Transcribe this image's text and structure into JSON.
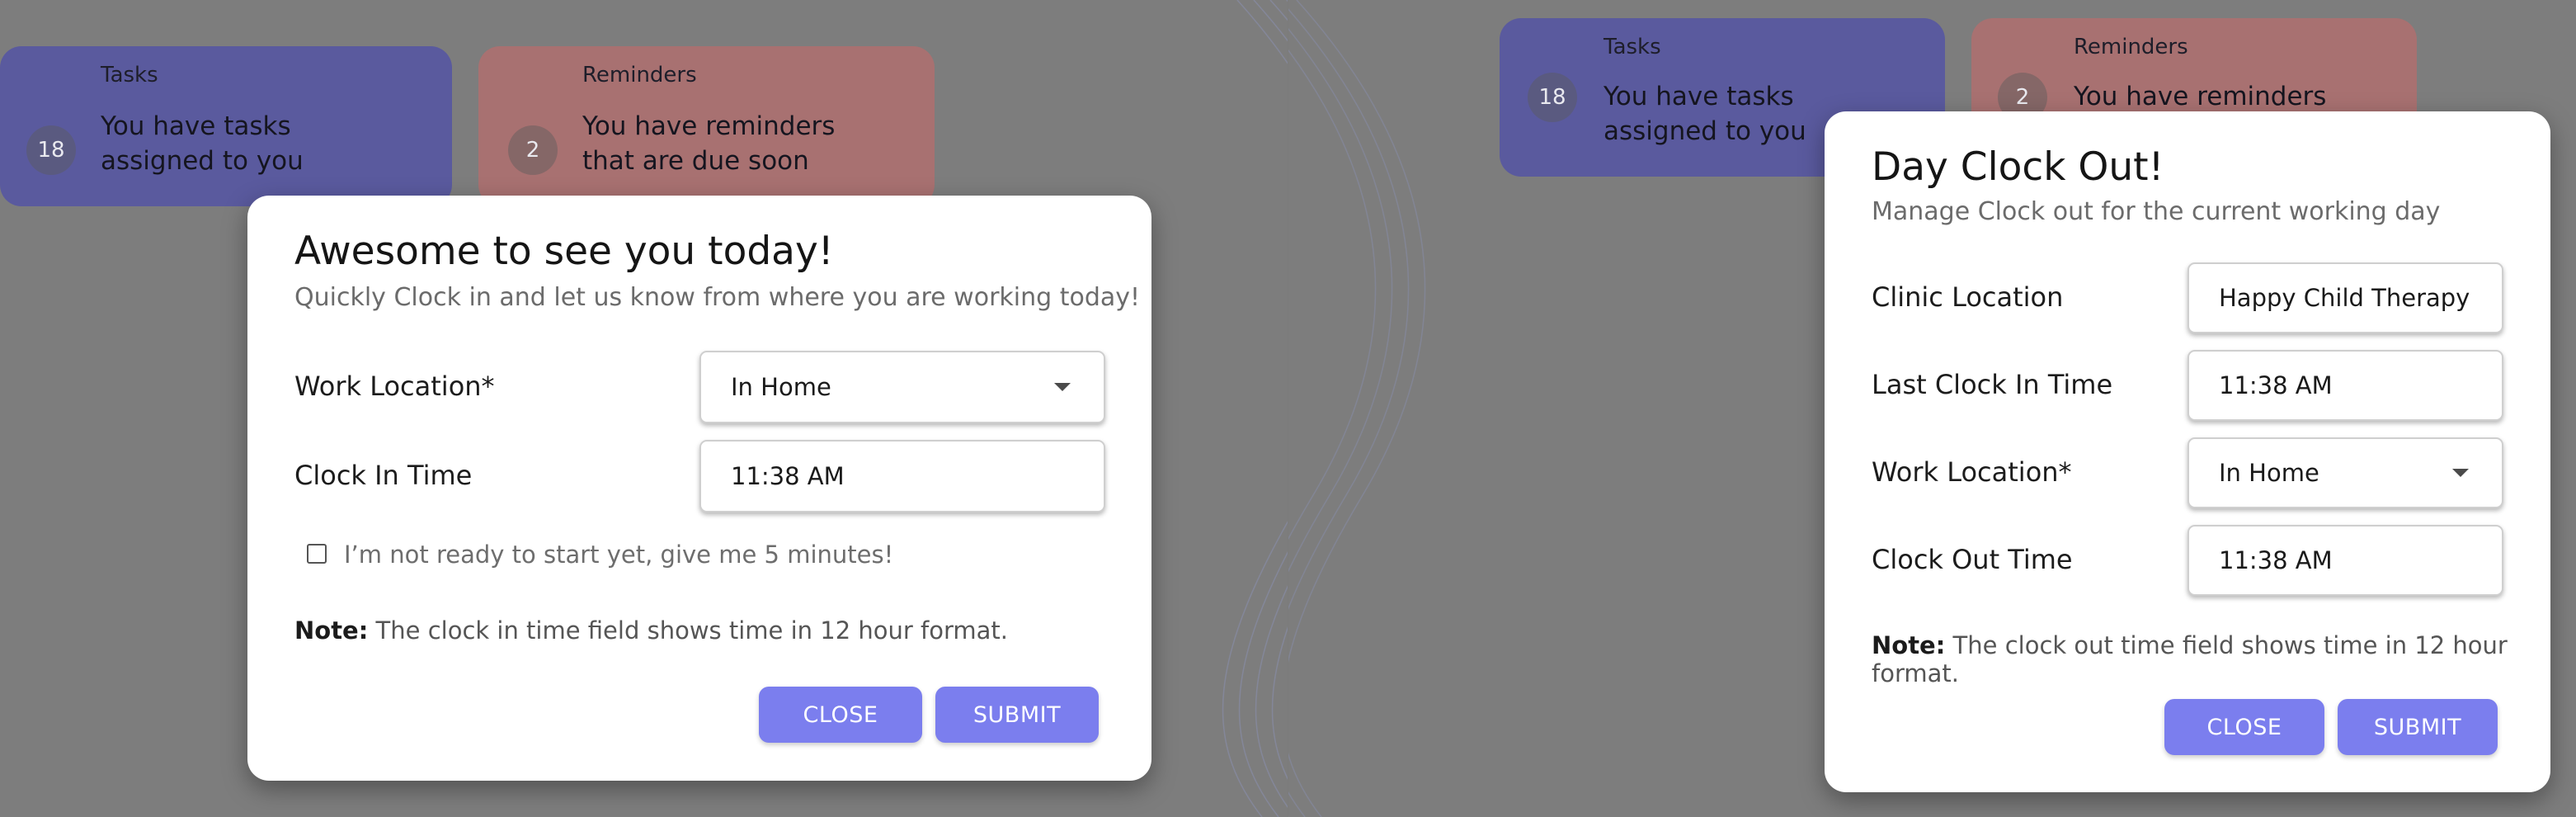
{
  "colors": {
    "overlay": "#7d7d7d",
    "tasks_card": "#5a5a9e",
    "reminders_card": "#a87171",
    "primary_button": "#7b7eee"
  },
  "left": {
    "tasks": {
      "title": "Tasks",
      "count": "18",
      "line1": "You have tasks",
      "line2": "assigned to you"
    },
    "reminders": {
      "title": "Reminders",
      "count": "2",
      "line1": "You have reminders",
      "line2": "that are due soon"
    },
    "modal": {
      "title": "Awesome to see you today!",
      "subtitle": "Quickly Clock in and let us know from where you are working today!",
      "work_location_label": "Work Location*",
      "work_location_value": "In Home",
      "clock_in_label": "Clock In Time",
      "clock_in_value": "11:38 AM",
      "checkbox_label": "I’m not ready to start yet, give me 5 minutes!",
      "note_bold": "Note:",
      "note_text": " The clock in time field shows time in 12 hour format.",
      "close_label": "CLOSE",
      "submit_label": "SUBMIT"
    }
  },
  "right": {
    "tasks": {
      "title": "Tasks",
      "count": "18",
      "line1": "You have tasks",
      "line2": "assigned to you"
    },
    "reminders": {
      "title": "Reminders",
      "count": "2",
      "line1": "You have reminders"
    },
    "modal": {
      "title": "Day Clock Out!",
      "subtitle": "Manage Clock out for the current working day",
      "clinic_label": "Clinic Location",
      "clinic_value": "Happy Child Therapy",
      "last_clock_in_label": "Last Clock In Time",
      "last_clock_in_value": "11:38 AM",
      "work_location_label": "Work Location*",
      "work_location_value": "In Home",
      "clock_out_label": "Clock Out Time",
      "clock_out_value": "11:38 AM",
      "note_bold": "Note:",
      "note_text": " The clock out time field shows time in 12 hour format.",
      "close_label": "CLOSE",
      "submit_label": "SUBMIT"
    }
  }
}
